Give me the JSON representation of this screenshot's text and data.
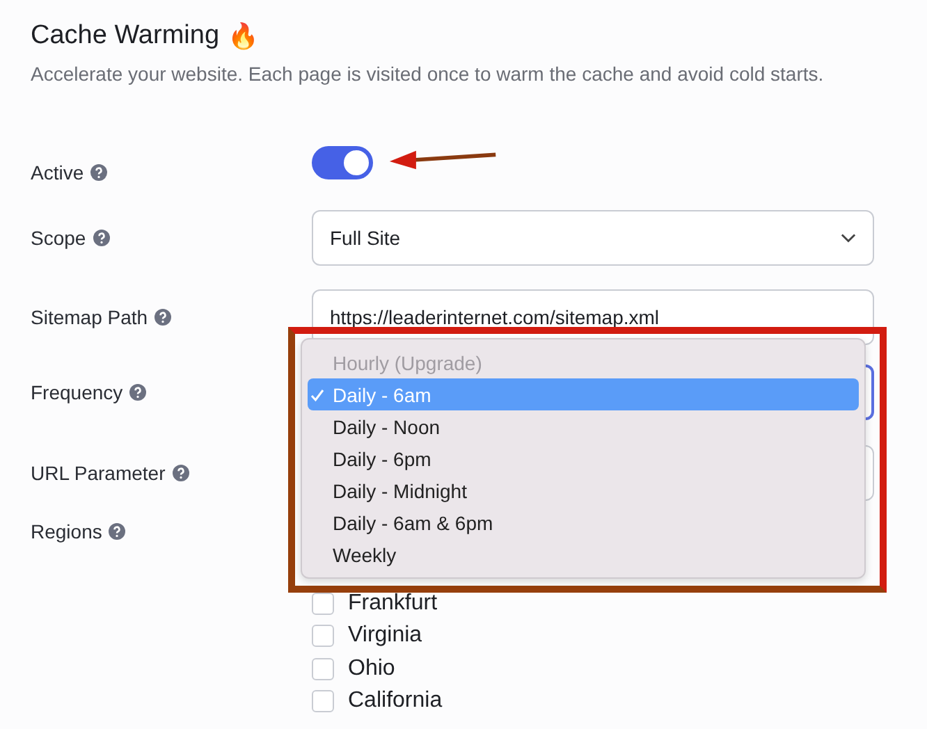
{
  "header": {
    "title": "Cache Warming",
    "icon": "🔥",
    "description": "Accelerate your website. Each page is visited once to warm the cache and avoid cold starts."
  },
  "fields": [
    {
      "label": "Active",
      "kind": "toggle",
      "on": true
    },
    {
      "label": "Scope",
      "kind": "select",
      "value": "Full Site"
    },
    {
      "label": "Sitemap Path",
      "kind": "input",
      "value": "https://leaderinternet.com/sitemap.xml"
    },
    {
      "label": "Frequency",
      "kind": "select"
    },
    {
      "label": "URL Parameter",
      "kind": "input"
    },
    {
      "label": "Regions",
      "kind": "checklist",
      "options": [
        {
          "label": "Frankfurt",
          "checked": false
        },
        {
          "label": "Virginia",
          "checked": false
        },
        {
          "label": "Ohio",
          "checked": false
        },
        {
          "label": "California",
          "checked": false
        }
      ]
    }
  ],
  "dropdown": {
    "options": [
      {
        "label": "Hourly (Upgrade)",
        "disabled": true,
        "selected": false
      },
      {
        "label": "Daily - 6am",
        "disabled": false,
        "selected": true
      },
      {
        "label": "Daily - Noon",
        "disabled": false,
        "selected": false
      },
      {
        "label": "Daily - 6pm",
        "disabled": false,
        "selected": false
      },
      {
        "label": "Daily - Midnight",
        "disabled": false,
        "selected": false
      },
      {
        "label": "Daily - 6am & 6pm",
        "disabled": false,
        "selected": false
      },
      {
        "label": "Weekly",
        "disabled": false,
        "selected": false
      }
    ]
  }
}
